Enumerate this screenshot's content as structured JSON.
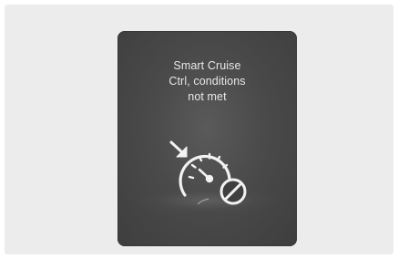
{
  "warning": {
    "lines": [
      "Smart Cruise",
      "Ctrl, conditions",
      "not met"
    ]
  },
  "icons": {
    "indicator": "arrow-pointer-icon",
    "main": "speedometer-icon",
    "status": "prohibited-icon"
  },
  "colors": {
    "page_background": "#ececec",
    "panel_background": "#4a4a4a",
    "text": "#e8e8e8",
    "icon": "#f2f2f2"
  }
}
